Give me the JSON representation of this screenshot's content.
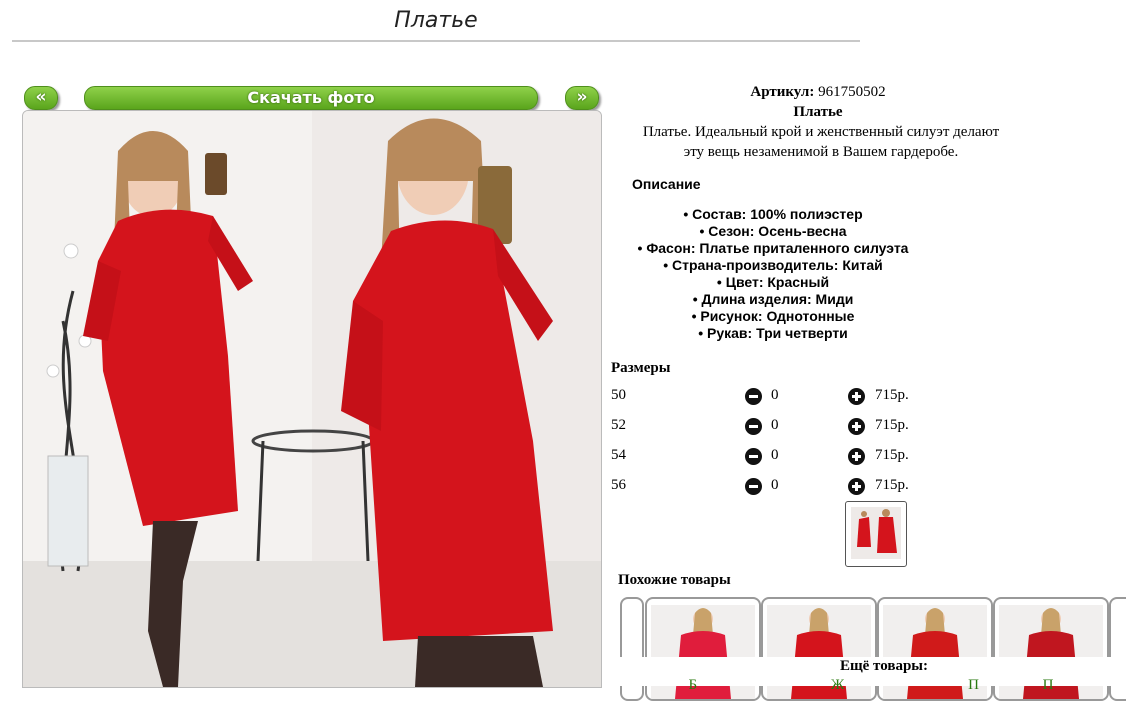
{
  "header": {
    "title": "Платье"
  },
  "gallery": {
    "prev_label": "«",
    "download_label": "Скачать фото",
    "next_label": "»"
  },
  "product": {
    "sku_label": "Артикул:",
    "sku": "961750502",
    "name": "Платье",
    "summary": "Платье. Идеальный крой и женственный силуэт делают эту вещь незаменимой в Вашем гардеробе.",
    "description_heading": "Описание",
    "specs": [
      "Состав: 100% полиэстер",
      "Сезон: Осень-весна",
      "Фасон: Платье приталенного силуэта",
      "Страна-производитель: Китай",
      "Цвет: Красный",
      "Длина изделия: Миди",
      "Рисунок: Однотонные",
      "Рукав: Три четверти"
    ]
  },
  "sizes": {
    "heading": "Размеры",
    "rows": [
      {
        "size": "50",
        "qty": "0",
        "price": "715р."
      },
      {
        "size": "52",
        "qty": "0",
        "price": "715р."
      },
      {
        "size": "54",
        "qty": "0",
        "price": "715р."
      },
      {
        "size": "56",
        "qty": "0",
        "price": "715р."
      }
    ]
  },
  "similar": {
    "heading": "Похожие товары"
  },
  "more": {
    "heading": "Ещё товары:",
    "links": [
      "Б",
      "Ж",
      "П",
      "П"
    ]
  },
  "colors": {
    "accent_green": "#6bb52a",
    "dress_red": "#d4141c",
    "link_green": "#2a7a10"
  },
  "icons": [
    "minus-circle-icon",
    "plus-circle-icon"
  ]
}
